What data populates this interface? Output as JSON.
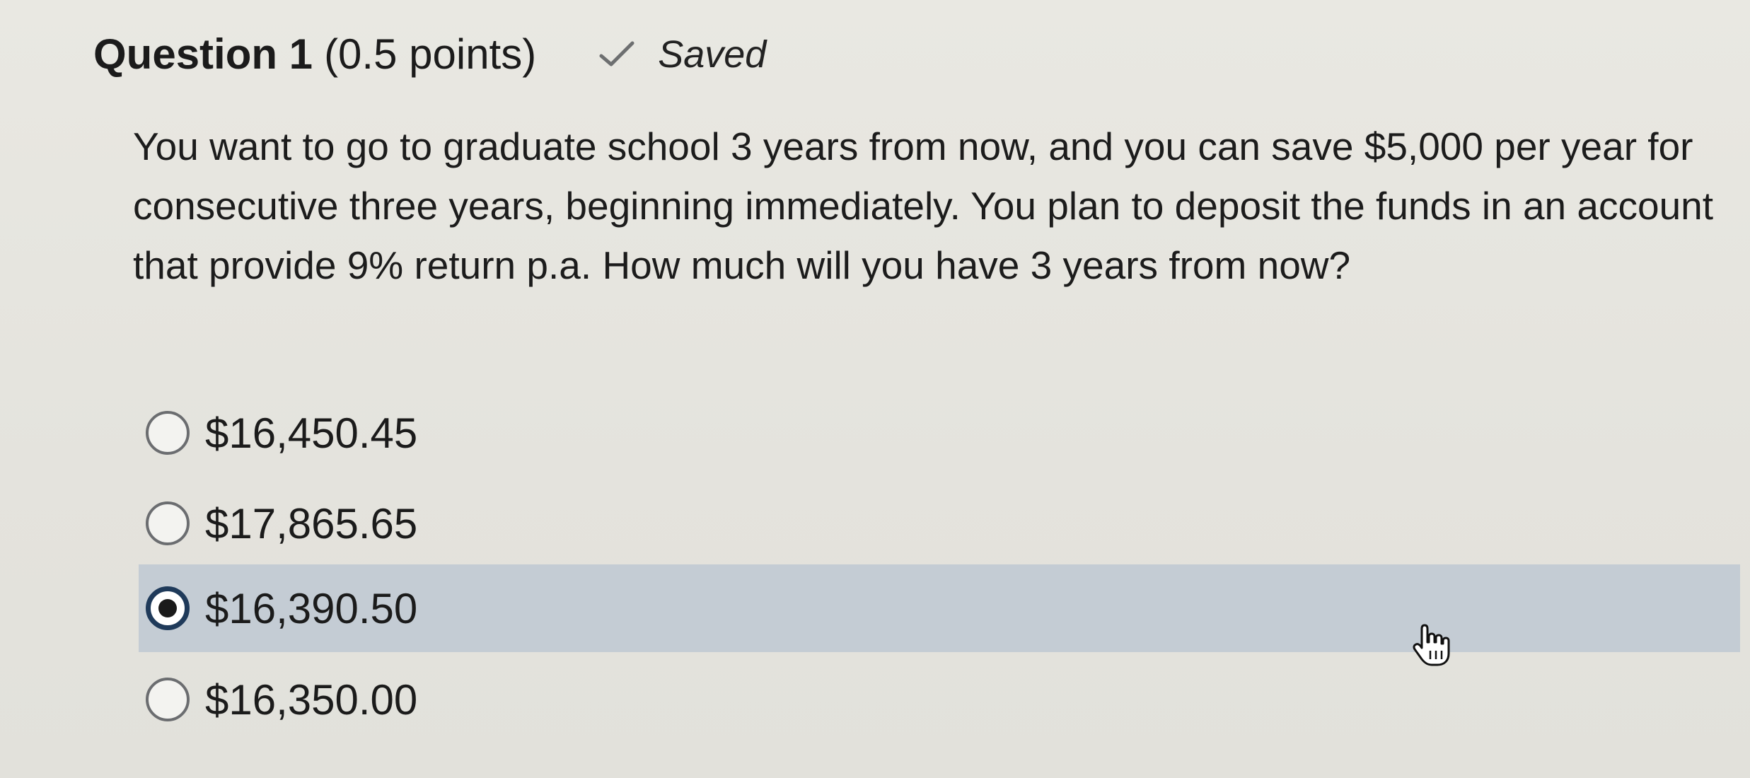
{
  "question": {
    "title": "Question 1",
    "points": "(0.5 points)",
    "status_icon": "check-icon",
    "status": "Saved",
    "text": "You want to go to graduate school 3 years from now, and you can save $5,000 per year for consecutive three years, beginning immediately.  You plan to deposit the funds in an account that provide 9% return p.a.  How much will you have 3 years from now?"
  },
  "options": [
    {
      "label": "$16,450.45",
      "selected": false
    },
    {
      "label": "$17,865.65",
      "selected": false
    },
    {
      "label": "$16,390.50",
      "selected": true
    },
    {
      "label": "$16,350.00",
      "selected": false
    }
  ],
  "colors": {
    "selected_row_bg": "#c4ccd4",
    "selected_radio_ring": "#1f3a5a",
    "background": "#e6e5df"
  },
  "cursor_icon": "hand-pointer-icon"
}
